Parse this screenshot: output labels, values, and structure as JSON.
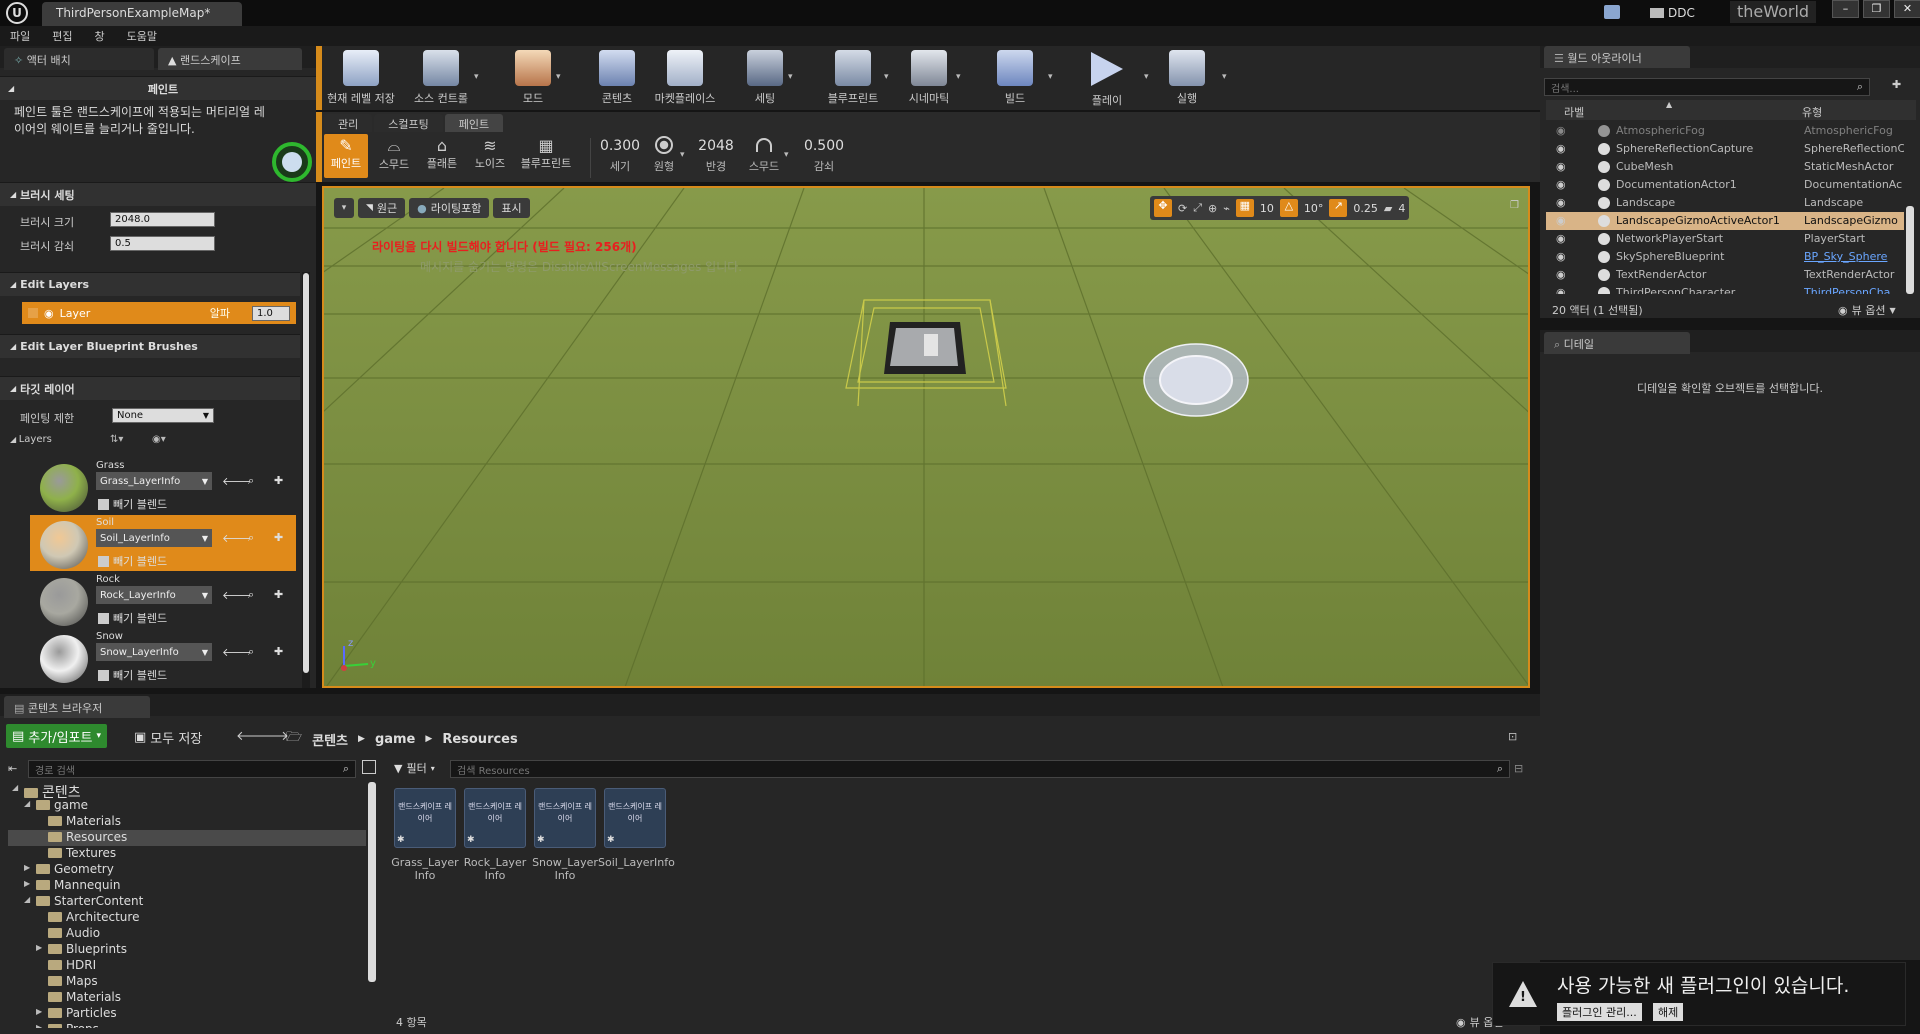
{
  "title_bar": {
    "logo": "U",
    "doc_tab": "ThirdPersonExampleMap*",
    "ddc": "DDC",
    "world": "theWorld"
  },
  "menu": [
    "파일",
    "편집",
    "창",
    "도움말"
  ],
  "left_tabs": {
    "place": "액터 배치",
    "landscape": "랜드스케이프"
  },
  "paint": {
    "title": "페인트",
    "desc": "페인트 툴은 랜드스케이프에 적용되는 머티리얼 레이어의 웨이트를 늘리거나 줄입니다.",
    "brush_settings": "브러시 세팅",
    "brush_size_label": "브러시 크기",
    "brush_size_value": "2048.0",
    "brush_falloff_label": "브러시 감쇠",
    "brush_falloff_value": "0.5",
    "edit_layers": "Edit Layers",
    "layer_name": "Layer",
    "alpha_label": "알파",
    "alpha_value": "1.0",
    "edit_layer_bp": "Edit Layer Blueprint Brushes",
    "target_layers": "타깃 레이어",
    "paint_limit_label": "페인팅 제한",
    "paint_limit_value": "None",
    "layers_label": "Layers",
    "layers": [
      {
        "name": "Grass",
        "info": "Grass_LayerInfo",
        "blend": "빼기 블렌드",
        "color": "#8fb14a",
        "selected": false
      },
      {
        "name": "Soil",
        "info": "Soil_LayerInfo",
        "blend": "빼기 블렌드",
        "color": "#cfc8b4",
        "selected": true
      },
      {
        "name": "Rock",
        "info": "Rock_LayerInfo",
        "blend": "빼기 블렌드",
        "color": "#a8a8a0",
        "selected": false
      },
      {
        "name": "Snow",
        "info": "Snow_LayerInfo",
        "blend": "빼기 블렌드",
        "color": "#f0f0f0",
        "selected": false
      }
    ]
  },
  "toolbar": {
    "save": "현재 레벨 저장",
    "source": "소스 컨트롤",
    "modes": "모드",
    "content": "콘텐츠",
    "market": "마켓플레이스",
    "settings": "세팅",
    "blueprint": "블루프린트",
    "cinematic": "시네마틱",
    "build": "빌드",
    "play": "플레이",
    "launch": "실행"
  },
  "mode_tabs": [
    "관리",
    "스컬프팅",
    "페인트"
  ],
  "tools": [
    "페인트",
    "스무드",
    "플래튼",
    "노이즈",
    "블루프린트"
  ],
  "tool_values": [
    {
      "value": "0.300",
      "label": "세기"
    },
    {
      "value": "",
      "label": "원형"
    },
    {
      "value": "2048",
      "label": "반경"
    },
    {
      "value": "",
      "label": "스무드"
    },
    {
      "value": "0.500",
      "label": "감쇠"
    }
  ],
  "viewport": {
    "perspective": "원근",
    "lighting": "라이팅포함",
    "show": "표시",
    "warn": "라이팅을 다시 빌드해야 합니다 (빌드 필요: 256개)",
    "hint": "메시지를 숨기는 명령은 DisableAllScreenMessages 입니다.",
    "grid": "10",
    "angle": "10°",
    "scale": "0.25",
    "speed": "4"
  },
  "outliner": {
    "tab": "월드 아웃라이너",
    "search_placeholder": "검색...",
    "col_label": "라벨",
    "col_type": "유형",
    "rows": [
      {
        "name": "AtmosphericFog",
        "type": "AtmosphericFog",
        "selected": false
      },
      {
        "name": "SphereReflectionCapture",
        "type": "SphereReflectionC",
        "selected": false
      },
      {
        "name": "CubeMesh",
        "type": "StaticMeshActor",
        "selected": false
      },
      {
        "name": "DocumentationActor1",
        "type": "DocumentationAc",
        "selected": false
      },
      {
        "name": "Landscape",
        "type": "Landscape",
        "selected": false
      },
      {
        "name": "LandscapeGizmoActiveActor1",
        "type": "LandscapeGizmo",
        "selected": true
      },
      {
        "name": "NetworkPlayerStart",
        "type": "PlayerStart",
        "selected": false
      },
      {
        "name": "SkySphereBlueprint",
        "type": "BP_Sky_Sphere",
        "selected": false
      },
      {
        "name": "TextRenderActor",
        "type": "TextRenderActor",
        "selected": false
      },
      {
        "name": "ThirdPersonCharacter",
        "type": "ThirdPersonCha",
        "selected": false
      }
    ],
    "count": "20 액터 (1 선택됨)",
    "view_options": "뷰 옵션"
  },
  "details": {
    "tab": "디테일",
    "empty": "디테일을 확인할 오브젝트를 선택합니다."
  },
  "content_browser": {
    "tab": "콘텐츠 브라우저",
    "add_import": "추가/임포트",
    "save_all": "모두 저장",
    "crumbs": [
      "콘텐츠",
      "game",
      "Resources"
    ],
    "path_search": "경로 검색",
    "filter": "필터",
    "search_placeholder": "검색 Resources",
    "tree": [
      {
        "label": "콘텐츠",
        "depth": 0,
        "arrow": "◢"
      },
      {
        "label": "game",
        "depth": 1,
        "arrow": "◢"
      },
      {
        "label": "Materials",
        "depth": 2,
        "arrow": ""
      },
      {
        "label": "Resources",
        "depth": 2,
        "arrow": ""
      },
      {
        "label": "Textures",
        "depth": 2,
        "arrow": ""
      },
      {
        "label": "Geometry",
        "depth": 1,
        "arrow": "▶"
      },
      {
        "label": "Mannequin",
        "depth": 1,
        "arrow": "▶"
      },
      {
        "label": "StarterContent",
        "depth": 1,
        "arrow": "◢"
      },
      {
        "label": "Architecture",
        "depth": 2,
        "arrow": ""
      },
      {
        "label": "Audio",
        "depth": 2,
        "arrow": ""
      },
      {
        "label": "Blueprints",
        "depth": 2,
        "arrow": "▶"
      },
      {
        "label": "HDRI",
        "depth": 2,
        "arrow": ""
      },
      {
        "label": "Maps",
        "depth": 2,
        "arrow": ""
      },
      {
        "label": "Materials",
        "depth": 2,
        "arrow": ""
      },
      {
        "label": "Particles",
        "depth": 2,
        "arrow": "▶"
      },
      {
        "label": "Props",
        "depth": 2,
        "arrow": "▶"
      }
    ],
    "asset_type": "랜드스케이프 레이어",
    "assets": [
      "Grass_Layer Info",
      "Rock_Layer Info",
      "Snow_Layer Info",
      "Soil_LayerInfo"
    ],
    "count": "4 항목",
    "view_options": "뷰 옵션"
  },
  "notification": {
    "text": "사용 가능한 새 플러그인이 있습니다.",
    "manage": "플러그인 관리...",
    "dismiss": "해제"
  }
}
